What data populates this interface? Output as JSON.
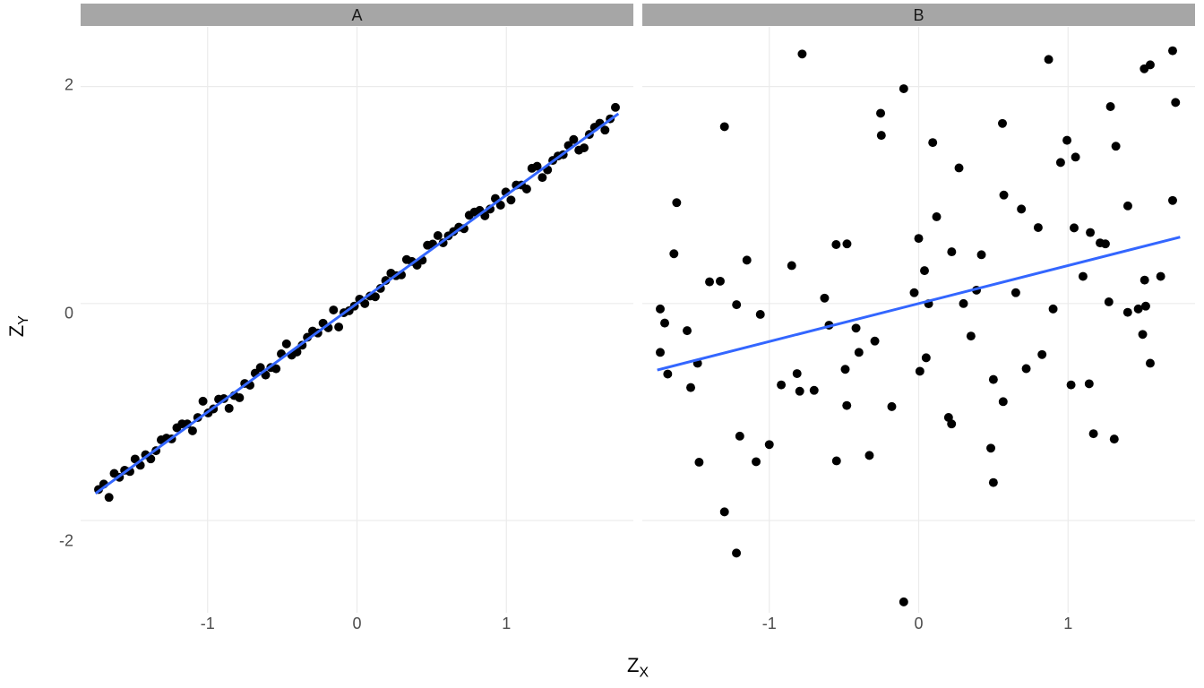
{
  "chart_data": [
    {
      "type": "scatter",
      "facet_label": "A",
      "xlabel": "Z_X",
      "ylabel": "Z_Y",
      "xlim": [
        -1.85,
        1.85
      ],
      "ylim": [
        -2.85,
        2.55
      ],
      "x_ticks": [
        -1,
        0,
        1
      ],
      "y_ticks": [
        -2,
        0,
        2
      ],
      "regression": {
        "slope": 1.0,
        "intercept": 0.0,
        "color": "#3366ff"
      },
      "n_points": 100,
      "note": "Points lie almost exactly on the 1:1 line (standardised Y ≈ standardised X).",
      "points_sample": [
        [
          -1.73,
          -1.73
        ],
        [
          -1.6,
          -1.58
        ],
        [
          -1.45,
          -1.47
        ],
        [
          -1.3,
          -1.28
        ],
        [
          -1.15,
          -1.17
        ],
        [
          -1.0,
          -0.98
        ],
        [
          -0.85,
          -0.87
        ],
        [
          -0.7,
          -0.68
        ],
        [
          -0.55,
          -0.57
        ],
        [
          -0.4,
          -0.38
        ],
        [
          -0.25,
          -0.27
        ],
        [
          -0.1,
          -0.08
        ],
        [
          0.05,
          0.03
        ],
        [
          0.2,
          0.22
        ],
        [
          0.35,
          0.33
        ],
        [
          0.5,
          0.52
        ],
        [
          0.65,
          0.63
        ],
        [
          0.8,
          0.82
        ],
        [
          0.95,
          0.93
        ],
        [
          1.1,
          1.12
        ],
        [
          1.25,
          1.23
        ],
        [
          1.4,
          1.42
        ],
        [
          1.55,
          1.53
        ],
        [
          1.7,
          1.77
        ]
      ]
    },
    {
      "type": "scatter",
      "facet_label": "B",
      "xlabel": "Z_X",
      "ylabel": "Z_Y",
      "xlim": [
        -1.85,
        1.85
      ],
      "ylim": [
        -2.85,
        2.55
      ],
      "x_ticks": [
        -1,
        0,
        1
      ],
      "y_ticks": [
        -2,
        0,
        2
      ],
      "regression": {
        "slope": 0.35,
        "intercept": 0.0,
        "color": "#3366ff"
      },
      "n_points": 100,
      "note": "Widely scattered cloud; weak positive linear trend.",
      "points_sample": [
        [
          -1.73,
          -0.45
        ],
        [
          -1.73,
          -0.05
        ],
        [
          -1.68,
          -0.65
        ],
        [
          -1.62,
          0.93
        ],
        [
          -1.55,
          -0.25
        ],
        [
          -1.48,
          -0.55
        ],
        [
          -1.4,
          0.2
        ],
        [
          -1.3,
          1.63
        ],
        [
          -1.3,
          -1.92
        ],
        [
          -1.22,
          -2.3
        ],
        [
          -1.15,
          0.4
        ],
        [
          -1.06,
          -0.1
        ],
        [
          -1.0,
          -1.3
        ],
        [
          -0.92,
          -0.75
        ],
        [
          -0.85,
          0.35
        ],
        [
          -0.78,
          2.3
        ],
        [
          -0.7,
          -0.8
        ],
        [
          -0.63,
          0.05
        ],
        [
          -0.55,
          -1.45
        ],
        [
          -0.48,
          0.55
        ],
        [
          -0.4,
          -0.45
        ],
        [
          -0.33,
          -1.4
        ],
        [
          -0.25,
          1.55
        ],
        [
          -0.18,
          -0.95
        ],
        [
          -0.1,
          1.98
        ],
        [
          -0.1,
          -2.75
        ],
        [
          -0.03,
          0.1
        ],
        [
          0.05,
          -0.5
        ],
        [
          0.12,
          0.8
        ],
        [
          0.2,
          -1.05
        ],
        [
          0.27,
          1.25
        ],
        [
          0.35,
          -0.3
        ],
        [
          0.42,
          0.45
        ],
        [
          0.5,
          -1.65
        ],
        [
          0.5,
          -0.7
        ],
        [
          0.57,
          1.0
        ],
        [
          0.65,
          0.1
        ],
        [
          0.72,
          -0.6
        ],
        [
          0.8,
          0.7
        ],
        [
          0.87,
          2.25
        ],
        [
          0.95,
          1.3
        ],
        [
          1.02,
          -0.75
        ],
        [
          1.1,
          0.25
        ],
        [
          1.17,
          -1.2
        ],
        [
          1.25,
          0.55
        ],
        [
          1.32,
          1.45
        ],
        [
          1.4,
          0.9
        ],
        [
          1.47,
          -0.05
        ],
        [
          1.55,
          2.2
        ],
        [
          1.55,
          -0.55
        ],
        [
          1.62,
          0.25
        ],
        [
          1.7,
          2.33
        ],
        [
          1.7,
          0.95
        ],
        [
          -1.7,
          -0.18
        ],
        [
          -0.6,
          -0.2
        ],
        [
          0.0,
          0.6
        ],
        [
          0.3,
          0.0
        ],
        [
          0.9,
          -0.05
        ],
        [
          1.05,
          1.35
        ]
      ]
    }
  ],
  "labels": {
    "y_axis": "Z<sub>Y</sub>",
    "x_axis": "Z<sub>X</sub>",
    "y_axis_plain": "Z_Y",
    "x_axis_plain": "Z_X"
  },
  "y_ticks": [
    "-2",
    "0",
    "2"
  ],
  "x_ticks": [
    "-1",
    "0",
    "1"
  ],
  "strip_labels": [
    "A",
    "B"
  ],
  "colors": {
    "line": "#3366ff",
    "point": "#000000",
    "strip_bg": "#a6a6a6",
    "grid": "#ebebeb"
  }
}
